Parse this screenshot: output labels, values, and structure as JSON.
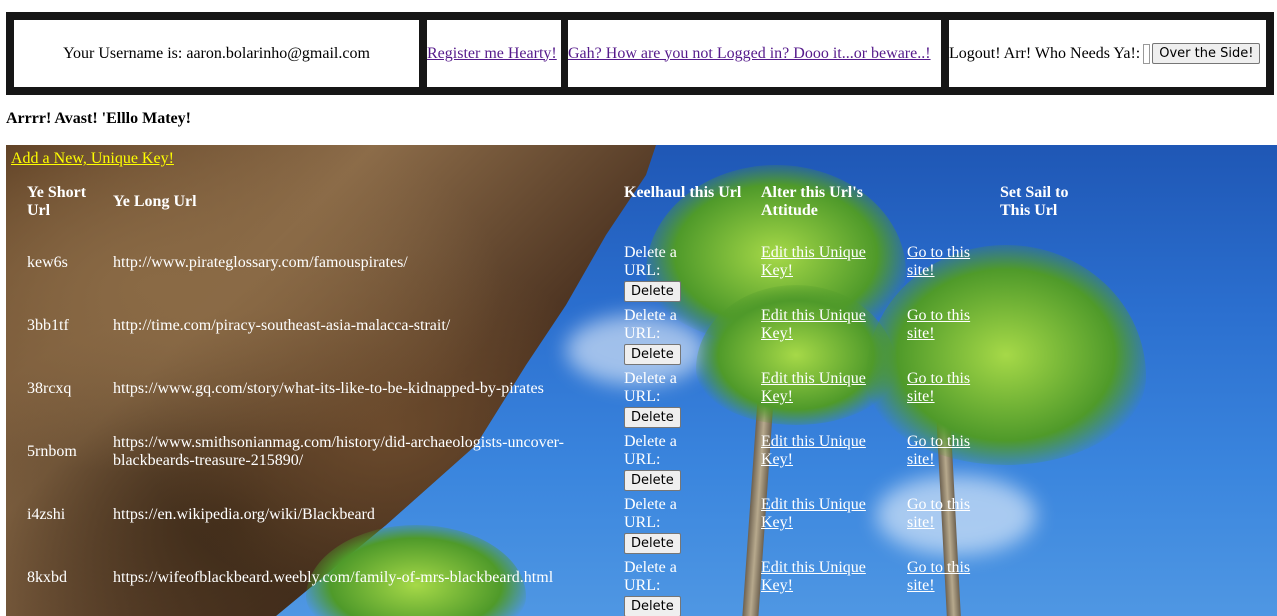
{
  "header": {
    "username_text": "Your Username is: aaron.bolarinho@gmail.com",
    "register_link": "Register me Hearty!",
    "login_link": "Gah? How are you not Logged in? Dooo it...or beware..!",
    "logout_label": "Logout! Arr! Who Needs Ya!:",
    "logout_button": "Over the Side!"
  },
  "greeting": "Arrrr! Avast! 'Elllo Matey!",
  "add_key_link": "Add a New, Unique Key!",
  "columns": {
    "short": "Ye Short Url",
    "long": "Ye Long Url",
    "delete": "Keelhaul this Url",
    "edit": "Alter this Url's Attitude",
    "visit": "Set Sail to This Url"
  },
  "row_labels": {
    "delete_label": "Delete a URL:",
    "delete_button": "Delete",
    "edit_link": "Edit this Unique Key!",
    "visit_link": "Go to this site!"
  },
  "rows": [
    {
      "short": "kew6s",
      "long": "http://www.pirateglossary.com/famouspirates/"
    },
    {
      "short": "3bb1tf",
      "long": "http://time.com/piracy-southeast-asia-malacca-strait/"
    },
    {
      "short": "38rcxq",
      "long": "https://www.gq.com/story/what-its-like-to-be-kidnapped-by-pirates"
    },
    {
      "short": "5rnbom",
      "long": "https://www.smithsonianmag.com/history/did-archaeologists-uncover-blackbeards-treasure-215890/"
    },
    {
      "short": "i4zshi",
      "long": "https://en.wikipedia.org/wiki/Blackbeard"
    },
    {
      "short": "8kxbd",
      "long": "https://wifeofblackbeard.weebly.com/family-of-mrs-blackbeard.html"
    }
  ]
}
